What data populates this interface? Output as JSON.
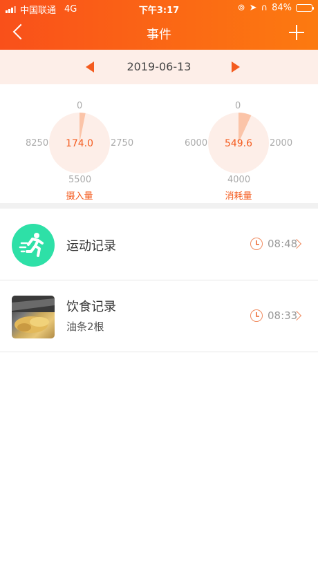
{
  "status": {
    "carrier": "中国联通",
    "network": "4G",
    "time": "下午3:17",
    "battery": "84%",
    "battery_level": 0.84
  },
  "navbar": {
    "title": "事件",
    "back_icon": "chevron-left-icon",
    "add_icon": "plus-icon"
  },
  "date_nav": {
    "date": "2019-06-13"
  },
  "gauges": [
    {
      "value": "174.0",
      "top": "0",
      "right": "2750",
      "bottom": "5500",
      "left": "8250",
      "label": "摄入量",
      "fraction": 0.0316
    },
    {
      "value": "549.6",
      "top": "0",
      "right": "2000",
      "bottom": "4000",
      "left": "6000",
      "label": "消耗量",
      "fraction": 0.0687
    }
  ],
  "records": [
    {
      "title": "运动记录",
      "subtitle": "",
      "time": "08:48",
      "icon": "running-person-icon"
    },
    {
      "title": "饮食记录",
      "subtitle": "油条2根",
      "time": "08:33",
      "icon": "food-photo"
    }
  ],
  "colors": {
    "accent": "#f45b1e",
    "gauge_bg": "#fdeee8",
    "gauge_fill": "#fbc4a8",
    "run_icon_bg": "#2ee0a7"
  }
}
